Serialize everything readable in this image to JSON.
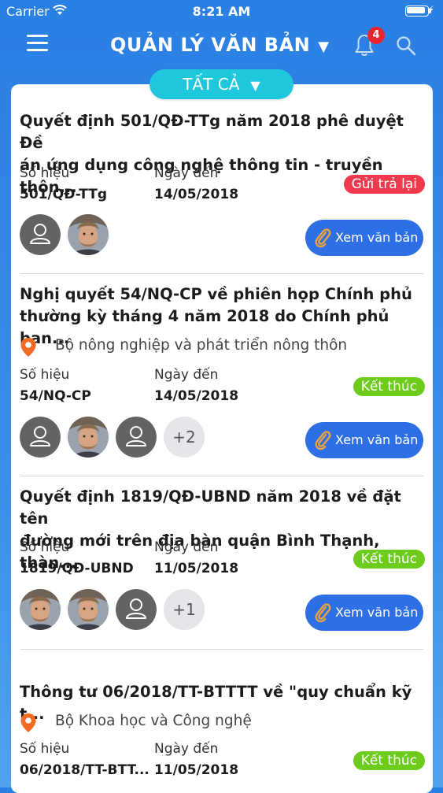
{
  "status_bar": {
    "carrier": "Carrier",
    "time": "8:21 AM"
  },
  "nav": {
    "title": "QUẢN LÝ VĂN BẢN",
    "notification_count": "4"
  },
  "filter": {
    "label": "TẤT CẢ"
  },
  "labels": {
    "number": "Số hiệu",
    "date": "Ngày đến",
    "view": "Xem văn bản"
  },
  "documents": [
    {
      "title_line1": "Quyết định 501/QĐ-TTg năm 2018 phê duyệt Đề",
      "title_line2": "án ứng dụng công nghệ thông tin - truyền thôn...",
      "number": "501/QĐ-TTg",
      "date": "14/05/2018",
      "status": "Gửi trả lại",
      "status_color": "#ee3a4c",
      "avatars": [
        "placeholder",
        "photo"
      ]
    },
    {
      "title_line1": "Nghị quyết 54/NQ-CP về phiên họp Chính phủ",
      "title_line2": "thường kỳ tháng 4 năm 2018 do Chính phủ ban...",
      "organization": "Bộ nông nghiệp và phát triển nông thôn",
      "number": "54/NQ-CP",
      "date": "14/05/2018",
      "status": "Kết thúc",
      "status_color": "#6ccb1b",
      "avatars": [
        "placeholder",
        "photo",
        "placeholder"
      ],
      "more": "+2"
    },
    {
      "title_line1": "Quyết định 1819/QĐ-UBND năm 2018 về đặt tên",
      "title_line2": "đường mới trên địa bàn quận Bình Thạnh, thàn...",
      "number": "1819/QĐ-UBND",
      "date": "11/05/2018",
      "status": "Kết thúc",
      "status_color": "#6ccb1b",
      "avatars": [
        "photo",
        "photo",
        "placeholder"
      ],
      "more": "+1"
    },
    {
      "title_line1": "Thông tư 06/2018/TT-BTTTT về \"quy chuẩn kỹ t...",
      "organization": "Bộ Khoa học và Công nghệ",
      "number": "06/2018/TT-BTT...",
      "date": "11/05/2018",
      "status": "Kết thúc",
      "status_color": "#6ccb1b"
    }
  ],
  "icons": [
    "menu-icon",
    "caret-down-icon",
    "bell-icon",
    "search-icon",
    "location-pin-icon",
    "user-placeholder-icon",
    "paperclip-icon"
  ]
}
